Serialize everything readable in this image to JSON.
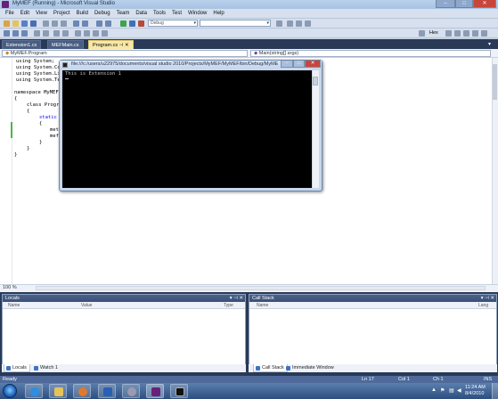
{
  "window": {
    "title": "MyMEF (Running) - Microsoft Visual Studio"
  },
  "menu": [
    "File",
    "Edit",
    "View",
    "Project",
    "Build",
    "Debug",
    "Team",
    "Data",
    "Tools",
    "Test",
    "Window",
    "Help"
  ],
  "toolbar": {
    "config": "Debug",
    "find_label": "Hex"
  },
  "doc_tabs": [
    {
      "label": "Extension1.cs"
    },
    {
      "label": "MEFMain.cs"
    },
    {
      "label": "Program.cs"
    }
  ],
  "nav": {
    "type_combo": "MyMEF.Program",
    "member_combo": "Main(string[] args)"
  },
  "code": {
    "lines": [
      [
        "using System;"
      ],
      [
        "using System.Co"
      ],
      [
        "using System.Li"
      ],
      [
        "using System.Te"
      ],
      [
        "namespace MyMEF"
      ],
      [
        "{"
      ],
      [
        "class Progr"
      ],
      [
        "{"
      ],
      [
        "static"
      ],
      [
        "{"
      ],
      [
        "meth"
      ],
      [
        "mef"
      ],
      [
        "}"
      ],
      [
        "}"
      ],
      [
        "}"
      ]
    ]
  },
  "editor": {
    "zoom": "100 %"
  },
  "console": {
    "title": "file:///c:/users/u22975/documents/visual studio 2010/Projects/MyMEF/MyMEF/bin/Debug/MyMEF....",
    "output": "This is Extension 1"
  },
  "locals": {
    "title": "Locals",
    "columns": [
      "Name",
      "Value",
      "Type"
    ],
    "tabs": [
      "Locals",
      "Watch 1"
    ]
  },
  "callstack": {
    "title": "Call Stack",
    "columns": [
      "Name",
      "Lang"
    ],
    "tabs": [
      "Call Stack",
      "Immediate Window"
    ]
  },
  "status": {
    "ready": "Ready",
    "ln": "Ln 17",
    "col": "Col 1",
    "ch": "Ch 1",
    "mode": "INS"
  },
  "clock": {
    "time": "11:24 AM",
    "date": "8/4/2010"
  },
  "colors": {
    "accent": "#2a3a56",
    "active_tab": "#f7e8a8",
    "status": "#4f6a9a"
  }
}
